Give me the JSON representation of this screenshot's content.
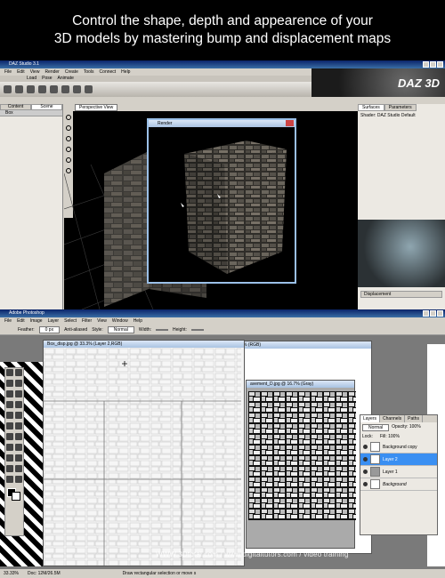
{
  "header": {
    "line1": "Control the shape, depth and appearence of your",
    "line2": "3D models by mastering bump and displacement maps"
  },
  "daz": {
    "title": "DAZ Studio 3.1",
    "menu": [
      "File",
      "Edit",
      "View",
      "Render",
      "Create",
      "Tools",
      "Connect",
      "Help"
    ],
    "tabs": [
      "Load",
      "Pose",
      "Animate"
    ],
    "logo": "DAZ 3D",
    "left_tabs": [
      "Content",
      "Scene"
    ],
    "scene_item": "Box",
    "viewport_select": "Perspective View",
    "right_tabs": [
      "Surfaces",
      "Parameters"
    ],
    "shader_label": "Shader: DAZ Studio Default",
    "displacement_label": "Displacement",
    "render_title": "Render"
  },
  "photoshop": {
    "title": "Adobe Photoshop",
    "menu": [
      "File",
      "Edit",
      "Image",
      "Layer",
      "Select",
      "Filter",
      "View",
      "Window",
      "Help"
    ],
    "options": {
      "feather_label": "Feather:",
      "feather_value": "0 px",
      "antialiased": "Anti-aliased",
      "style_label": "Style:",
      "style_value": "Normal",
      "width_label": "Width:",
      "height_label": "Height:"
    },
    "doc1_title": "Box_disp.jpg @ 33.3% (Layer 2,RGB)",
    "doc2_title": "% (RGB)",
    "doc3_title": "avement_D.jpg @ 16.7% (Gray)",
    "layers_tabs": [
      "Layers",
      "Channels",
      "Paths"
    ],
    "blend_mode": "Normal",
    "opacity": "Opacity: 100%",
    "lock_label": "Lock:",
    "fill": "Fill: 100%",
    "layers": [
      "Background copy",
      "Layer 2",
      "Layer 1",
      "Background"
    ],
    "status_zoom": "33.33%",
    "status_doc": "Doc: 12M/26.5M",
    "status_hint": "Draw rectangular selection or move s"
  },
  "watermark": "WWW.3Dtotal.com / www.digitaltutors.com / video training"
}
